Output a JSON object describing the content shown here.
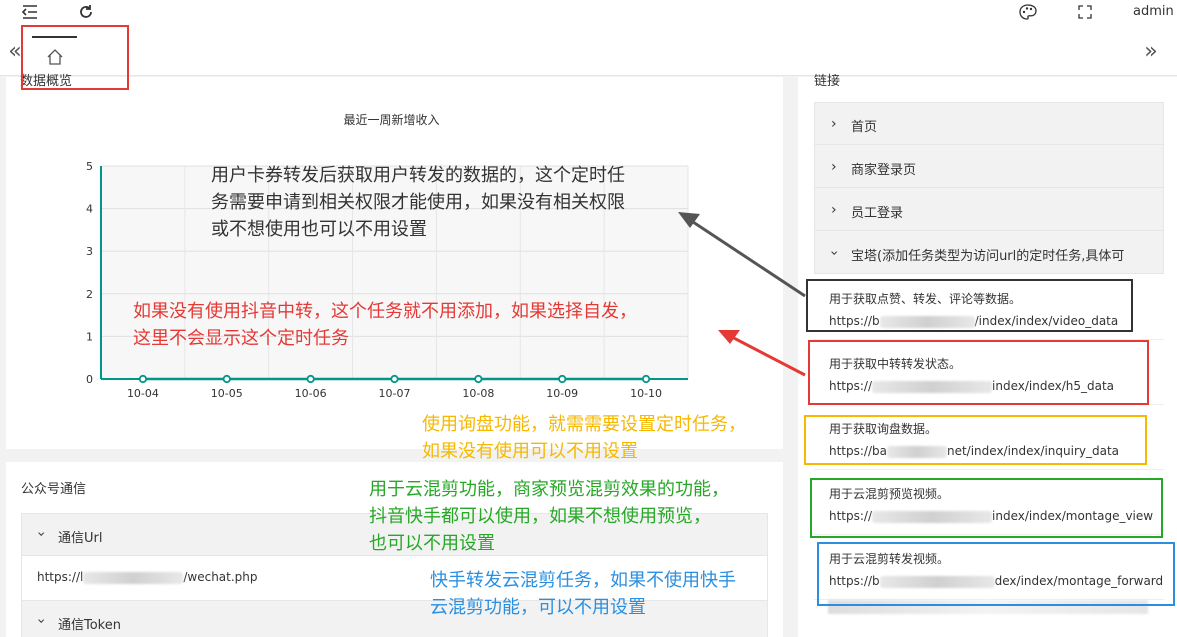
{
  "topbar": {
    "user": "admin"
  },
  "panels": {
    "overview_title": "数据概览",
    "links_title": "链接",
    "wechat_title": "公众号通信"
  },
  "chart_data": {
    "type": "line",
    "title": "最近一周新增收入",
    "categories": [
      "10-04",
      "10-05",
      "10-06",
      "10-07",
      "10-08",
      "10-09",
      "10-10"
    ],
    "values": [
      0,
      0,
      0,
      0,
      0,
      0,
      0
    ],
    "ylim": [
      0,
      5
    ],
    "yticks": [
      "0",
      "1",
      "2",
      "3",
      "4",
      "5"
    ],
    "color": "#009688",
    "grid": true
  },
  "links": {
    "items": [
      {
        "label": "首页"
      },
      {
        "label": "商家登录页"
      },
      {
        "label": "员工登录"
      },
      {
        "label": "宝塔(添加任务类型为访问url的定时任务,具体可"
      }
    ],
    "tasks": [
      {
        "desc": "用于获取点赞、转发、评论等数据。",
        "prefix": "https://b",
        "suffix": "/index/index/video_data"
      },
      {
        "desc": "用于获取中转转发状态。",
        "prefix": "https://",
        "suffix": "index/index/h5_data"
      },
      {
        "desc": "用于获取询盘数据。",
        "prefix": "https://ba",
        "suffix": "net/index/index/inquiry_data"
      },
      {
        "desc": "用于云混剪预览视频。",
        "prefix": "https://",
        "suffix": "index/index/montage_view"
      },
      {
        "desc": "用于云混剪转发视频。",
        "prefix": "https://b",
        "suffix": "dex/index/montage_forward"
      }
    ]
  },
  "wechat": {
    "url_label": "通信Url",
    "url_prefix": "https://l",
    "url_suffix": "/wechat.php",
    "token_label": "通信Token"
  },
  "annotations": {
    "gray": [
      "用户卡券转发后获取用户转发的数据的，这个定时任",
      "务需要申请到相关权限才能使用，如果没有相关权限",
      "或不想使用也可以不用设置"
    ],
    "red": [
      "如果没有使用抖音中转，这个任务就不用添加，如果选择自发，",
      "这里不会显示这个定时任务"
    ],
    "orange": [
      "使用询盘功能，就需需要设置定时任务，",
      "如果没有使用可以不用设置"
    ],
    "green": [
      "用于云混剪功能，商家预览混剪效果的功能，",
      "抖音快手都可以使用，如果不想使用预览，",
      "也可以不用设置"
    ],
    "blue": [
      "快手转发云混剪任务，如果不使用快手",
      "云混剪功能，可以不用设置"
    ]
  },
  "colors": {
    "accent": "#009688",
    "red": "#e53935",
    "gray": "#333333",
    "orange": "#f6b800",
    "green": "#26a826",
    "blue": "#2a8fe0"
  }
}
